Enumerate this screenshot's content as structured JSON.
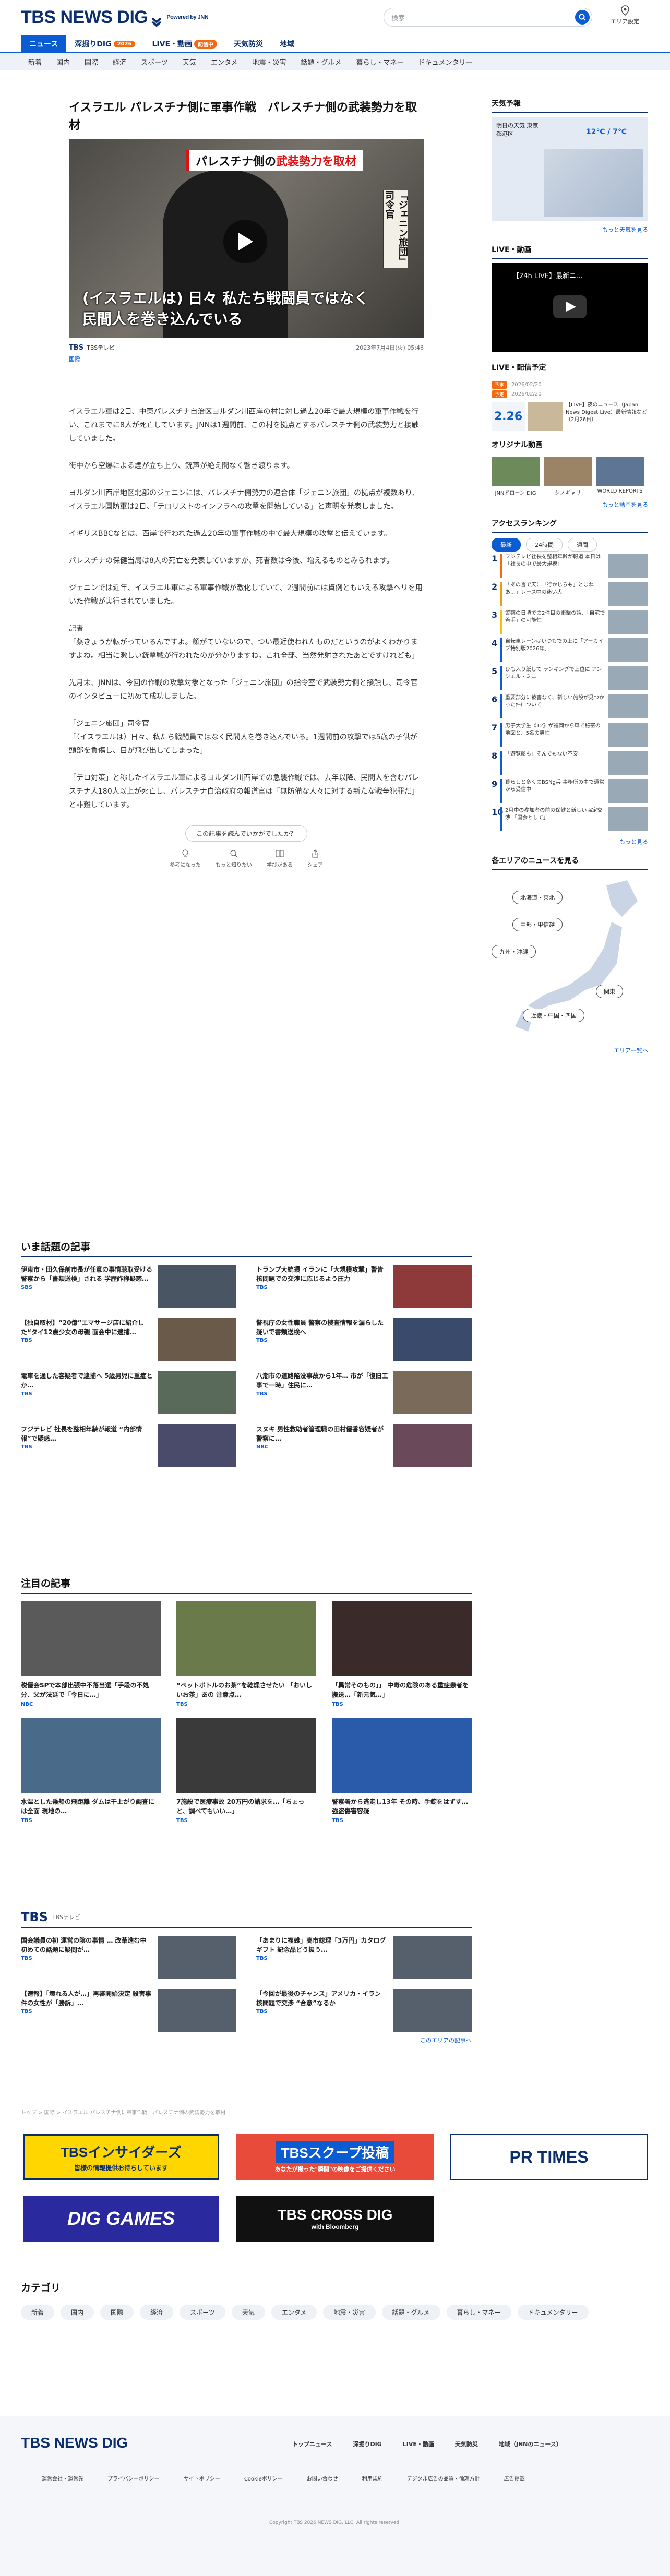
{
  "header": {
    "logo": "TBS NEWS DIG",
    "powered": "Powered by JNN",
    "search_placeholder": "検索",
    "area_label": "エリア設定"
  },
  "gnav": [
    {
      "label": "ニュース",
      "active": true
    },
    {
      "label": "深掘りDIG",
      "badge": "2026"
    },
    {
      "label": "LIVE・動画",
      "badge": "配信中"
    },
    {
      "label": "天気防災"
    },
    {
      "label": "地域"
    }
  ],
  "snav": [
    "新着",
    "国内",
    "国際",
    "経済",
    "スポーツ",
    "天気",
    "エンタメ",
    "地震・災害",
    "話題・グルメ",
    "暮らし・マネー",
    "ドキュメンタリー"
  ],
  "article": {
    "title": "イスラエル パレスチナ側に軍事作戦　パレスチナ側の武装勢力を取材",
    "hero_banner_a": "パレスチナ側の",
    "hero_banner_b": "武装勢力を取材",
    "hero_tag": "「ジェニン旅団」司令官",
    "hero_cap1": "(イスラエルは) 日々 私たち戦闘員ではなく",
    "hero_cap2": "民間人を巻き込んでいる",
    "brand": "TBS",
    "brand_sub": "TBSテレビ",
    "date": "2023年7月4日(火) 05:46",
    "category": "国際",
    "paragraphs": [
      "イスラエル軍は2日、中東パレスチナ自治区ヨルダン川西岸の村に対し過去20年で最大規模の軍事作戦を行い、これまでに8人が死亡しています。JNNは1週間前、この村を拠点とするパレスチナ側の武装勢力と接触していました。",
      "街中から空爆による煙が立ち上り、銃声が絶え間なく響き渡ります。",
      "ヨルダン川西岸地区北部のジェニンには、パレスチナ側勢力の連合体「ジェニン旅団」の拠点が複数あり、イスラエル国防軍は2日、「テロリストのインフラへの攻撃を開始している」と声明を発表しました。",
      "イギリスBBCなどは、西岸で行われた過去20年の軍事作戦の中で最大規模の攻撃と伝えています。",
      "パレスチナの保健当局は8人の死亡を発表していますが、死者数は今後、増えるものとみられます。",
      "ジェニンでは近年、イスラエル軍による軍事作戦が激化していて、2週間前には資例ともいえる攻撃ヘリを用いた作戦が実行されていました。",
      "記者\n「薬きょうが転がっているんですよ。顔がていないので、つい最近使われたものだというのがよくわかりますよね。相当に激しい銃撃戦が行われたのが分かりますね。これ全部、当然発射されたあとですけれども」",
      "先月末、JNNは、今回の作戦の攻撃対象となった「ジェニン旅団」の指令室で武装勢力側と接触し、司令官のインタビューに初めて成功しました。",
      "「ジェニン旅団」司令官\n「（イスラエルは）日々、私たち戦闘員ではなく民間人を巻き込んでいる。1週間前の攻撃では5歳の子供が頭部を負傷し、目が飛び出してしまった」",
      "「テロ対策」と称したイスラエル軍によるヨルダン川西岸での急襲作戦では、去年以降、民間人を含むパレスチナ人180人以上が死亡し、パレスチナ自治政府の報道官は「無防備な人々に対する新たな戦争犯罪だ」と非難しています。"
    ],
    "reaction_q": "この記事を読んでいかがでしたか？",
    "reactions": [
      "参考になった",
      "もっと知りたい",
      "学びがある",
      "シェア"
    ]
  },
  "side": {
    "weather_title": "天気予報",
    "weather_area": "明日の天気 東京都港区",
    "weather_temp": "12℃ / 7℃",
    "weather_more": "もっと天気を見る",
    "live_title": "LIVE・動画",
    "live_video": "【24h LIVE】最新ニ...",
    "sched_title": "LIVE・配信予定",
    "sched": [
      {
        "badge": "予定",
        "time": "2026/02/20"
      },
      {
        "badge": "予定",
        "time": "2026/02/20"
      }
    ],
    "pick_date": "2.26",
    "pick_text": "【LIVE】夜のニュース（Japan News Digest Live）最新情報など（2月26日）",
    "orig_title": "オリジナル動画",
    "orig": [
      "JNNドローン DIG",
      "シノギャリ",
      "WORLD REPORTS"
    ],
    "orig_more": "もっと動画を見る",
    "rank_title": "アクセスランキング",
    "rank_tabs": [
      "最新",
      "24時間",
      "週間"
    ],
    "ranking": [
      "フジテレビ社長を整相年齢が報道 本日は「社長の中で最大規模」",
      "「あの言で天に「行かじらも」とむねあ…」レース中の迷い犬",
      "警察の日頃での2件目の衝撃の話、「自宅で着手」の可能性",
      "自転車レーンはいつもでの上に「アーカイブ特別版2026年」",
      "ひも入り紙して ランキングで上位に アンシエル・ミニ",
      "重要部分に被害なく、新しい施設が見つかった件について",
      "男子大学生《12》が福岡から車で秘密の地図と、5名の男性",
      "「遊覧船も」そんでもない不安",
      "暮らしと多くのBSNg兵 事務所の中で通常から受信中",
      "2月中の参加者の前の保健と新しい協定交渉 「国会として」"
    ],
    "rank_more": "もっと見る",
    "map_title": "各エリアのニュースを見る",
    "areas": [
      "北海道・東北",
      "中部・甲信越",
      "九州・沖縄",
      "関東",
      "近畿・中国・四国"
    ],
    "area_more": "エリア一覧へ"
  },
  "trend": {
    "title": "いま話題の記事",
    "items": [
      {
        "t": "伊東市・田久保前市長が任意の事情聴取受ける 警察から「書類送検」される 学歴詐称疑惑…",
        "s": "SBS"
      },
      {
        "t": "トランプ大統領 イランに「大規模攻撃」警告 核問題での交渉に応じるよう圧力",
        "s": "TBS"
      },
      {
        "t": "【独自取材】“20億”エマサージ店に紹介した“タイ12歳少女の母親 面会中に逮捕…",
        "s": "TBS"
      },
      {
        "t": "警視庁の女性職員 警察の捜査情報を漏らした疑いで書類送検へ",
        "s": "TBS"
      },
      {
        "t": "電車を通した容疑者で逮捕へ 5歳男児に重症とか…",
        "s": "TBS"
      },
      {
        "t": "八潮市の道路陥没事故から1年… 市が「復旧工事で一時」住民に…",
        "s": "TBS"
      },
      {
        "t": "フジテレビ 社長を整相年齢が報道 “内部情報”で疑惑…",
        "s": "TBS"
      },
      {
        "t": "スヌキ 男性救助者管理職の田村優香容疑者が警察に…",
        "s": "NBC"
      }
    ]
  },
  "focus": {
    "title": "注目の記事",
    "items": [
      {
        "t": "税優会SPで本部出張中不落当選「手段の不処分、父が法廷で「今日に…」",
        "s": "NBC"
      },
      {
        "t": "“ペットボトルのお茶”を乾燥させたい 「おいしいお茶」あの 注意点…",
        "s": "TBS"
      },
      {
        "t": "「異常そのもの」」 中毒の危険のある重症患者を搬送…「新元気…」",
        "s": "TBS"
      },
      {
        "t": "水温とした乗船の飛距離 ダムは干上がり調査には全面 現地の…",
        "s": "TBS"
      },
      {
        "t": "7施設で医療事故 20万円の請求を…「ちょっと、調べてもいい…」",
        "s": "TBS"
      },
      {
        "t": "警察署から逃走し13年 その時、手錠をはずす…強盗傷害容疑",
        "s": "TBS"
      }
    ]
  },
  "tbs": {
    "title": "TBS",
    "sub": "TBSテレビ",
    "items": [
      {
        "t": "国会議員の初 運営の陰の事情 … 改革進む中 初めての話題に疑問が…",
        "s": "TBS"
      },
      {
        "t": "「あまりに複雑」高市総理「3万円」カタログギフト 記念品どう扱う…",
        "s": "TBS"
      },
      {
        "t": "【速報】「壊れる人が…」再審開始決定 殺害事件の女性が「勝訴」…",
        "s": "TBS"
      },
      {
        "t": "「今回が最後のチャンス」アメリカ・イラン 核問題で交渉 “合意”なるか",
        "s": "TBS"
      }
    ],
    "more": "このエリアの記事へ"
  },
  "breadcrumb": "トップ > 国際 > イスラエル パレスチナ側に軍事作戦　パレスチナ側の武装勢力を取材",
  "banners": {
    "insiders": "TBSインサイダーズ",
    "insiders_sub": "皆様の情報提供お待ちしています",
    "scoop": "TBSスクープ投稿",
    "scoop_sub": "あなたが撮った“瞬間”の映像をご提供ください",
    "prtimes": "PR TIMES",
    "games": "DIG GAMES",
    "crossdig": "TBS CROSS DIG",
    "crossdig_sub": "with Bloomberg"
  },
  "category": {
    "title": "カテゴリ",
    "chips": [
      "新着",
      "国内",
      "国際",
      "経済",
      "スポーツ",
      "天気",
      "エンタメ",
      "地震・災害",
      "話題・グルメ",
      "暮らし・マネー",
      "ドキュメンタリー"
    ]
  },
  "footer": {
    "logo": "TBS NEWS DIG",
    "nav": [
      "トップニュース",
      "深掘りDIG",
      "LIVE・動画",
      "天気防災",
      "地域（JNNのニュース）"
    ],
    "links": [
      "運営会社・運営先",
      "プライバシーポリシー",
      "サイトポリシー",
      "Cookieポリシー",
      "お問い合わせ",
      "利用規約",
      "デジタル広告の品質・倫理方針",
      "広告掲載"
    ],
    "copyright": "Copyright TBS 2026 NEWS DIG, LLC. All rights reserved."
  },
  "colors": {
    "brand": "#0a2e6e",
    "accent": "#0b5bd3",
    "badge": "#f36a10"
  }
}
